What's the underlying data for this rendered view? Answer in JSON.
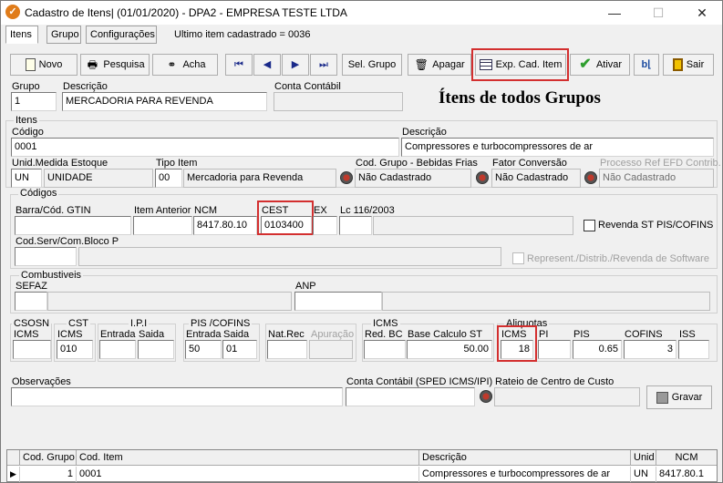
{
  "window": {
    "title": "Cadastro de Itens| (01/01/2020) - DPA2 - EMPRESA TESTE LTDA",
    "minimize": "—",
    "maximize": "☐",
    "close": "✕"
  },
  "tabs": [
    {
      "label": "Itens"
    },
    {
      "label": "Grupo"
    },
    {
      "label": "Configurações"
    }
  ],
  "last_item": "Ultimo item cadastrado = 0036",
  "toolbar": {
    "novo": "Novo",
    "pesquisa": "Pesquisa",
    "acha": "Acha",
    "first": "⏮",
    "prev": "◀",
    "next": "▶",
    "last": "⏭",
    "sel_grupo": "Sel. Grupo",
    "apagar": "Apagar",
    "exp_cad_item": "Exp. Cad. Item",
    "ativar": "Ativar",
    "sair": "Sair"
  },
  "header": {
    "grupo_label": "Grupo",
    "grupo_value": "1",
    "descricao_label": "Descrição",
    "descricao_value": "MERCADORIA PARA REVENDA",
    "conta_label": "Conta Contábil",
    "conta_value": "",
    "big_title": "Ítens de todos Grupos"
  },
  "itens": {
    "caption": "Itens",
    "codigo_label": "Código",
    "codigo_value": "0001",
    "descricao_label": "Descrição",
    "descricao_value": "Compressores e turbocompressores de ar",
    "unid_label": "Unid.Medida Estoque",
    "unid_code": "UN",
    "unid_name": "UNIDADE",
    "tipo_label": "Tipo Item",
    "tipo_code": "00",
    "tipo_name": "Mercadoria para Revenda",
    "cod_grupo_label": "Cod. Grupo - Bebidas Frias",
    "cod_grupo_value": "Não Cadastrado",
    "fator_label": "Fator Conversão",
    "fator_value": "Não Cadastrado",
    "processo_label": "Processo Ref EFD Contrib.",
    "processo_value": "Não Cadastrado"
  },
  "codigos": {
    "caption": "Códigos",
    "barra_label": "Barra/Cód. GTIN",
    "barra_value": "",
    "item_anterior_label": "Item Anterior",
    "item_anterior_value": "",
    "ncm_label": "NCM",
    "ncm_value": "8417.80.10",
    "cest_label": "CEST",
    "cest_value": "0103400",
    "ex_label": "EX",
    "ex_value": "",
    "lc_label": "Lc 116/2003",
    "lc_value": "",
    "revenda_label": "Revenda ST PIS/COFINS",
    "cod_serv_label": "Cod.Serv/Com.Bloco P",
    "cod_serv_value": "",
    "represent_label": "Represent./Distrib./Revenda de Software"
  },
  "combustiveis": {
    "caption": "Combustiveis",
    "sefaz_label": "SEFAZ",
    "anp_label": "ANP"
  },
  "tax": {
    "csosn_caption": "CSOSN",
    "csosn_icms_label": "ICMS",
    "csosn_icms_value": "",
    "cst_caption": "CST",
    "cst_icms_label": "ICMS",
    "cst_icms_value": "010",
    "ipi_caption": "I.P.I",
    "ipi_entrada_label": "Entrada",
    "ipi_saida_label": "Saida",
    "ipi_entrada_value": "",
    "ipi_saida_value": "",
    "pis_caption": "PIS /COFINS",
    "pis_entrada_label": "Entrada",
    "pis_saida_label": "Saida",
    "pis_entrada_value": "50",
    "pis_saida_value": "01",
    "natrec_label": "Nat.Rec",
    "apuracao_label": "Apuração",
    "icms_caption": "ICMS",
    "red_bc_label": "Red. BC",
    "red_bc_value": "",
    "base_calc_label": "Base Calculo ST",
    "base_calc_value": "50.00",
    "aliquotas_caption": "Aliquotas",
    "aliq_icms_label": "ICMS",
    "aliq_icms_value": "18",
    "aliq_pi_label": "PI",
    "aliq_pi_value": "",
    "aliq_pis_label": "PIS",
    "aliq_pis_value": "0.65",
    "aliq_cofins_label": "COFINS",
    "aliq_cofins_value": "3",
    "aliq_iss_label": "ISS",
    "aliq_iss_value": ""
  },
  "footer": {
    "obs_label": "Observações",
    "obs_value": "",
    "conta_sped_label": "Conta Contábil (SPED ICMS/IPI)",
    "conta_sped_value": "",
    "rateio_label": "Rateio de Centro de Custo",
    "rateio_value": "",
    "gravar": "Gravar"
  },
  "grid": {
    "columns": [
      "Cod. Grupo",
      "Cod. Item",
      "Descrição",
      "Unid",
      "NCM"
    ],
    "rows": [
      {
        "cod_grupo": "1",
        "cod_item": "0001",
        "descricao": "Compressores e turbocompressores de ar",
        "unid": "UN",
        "ncm": "8417.80.1"
      }
    ]
  },
  "colors": {
    "highlight": "#d32f2f",
    "window_bg": "#f0f0f0",
    "field_bg": "#ffffff"
  }
}
